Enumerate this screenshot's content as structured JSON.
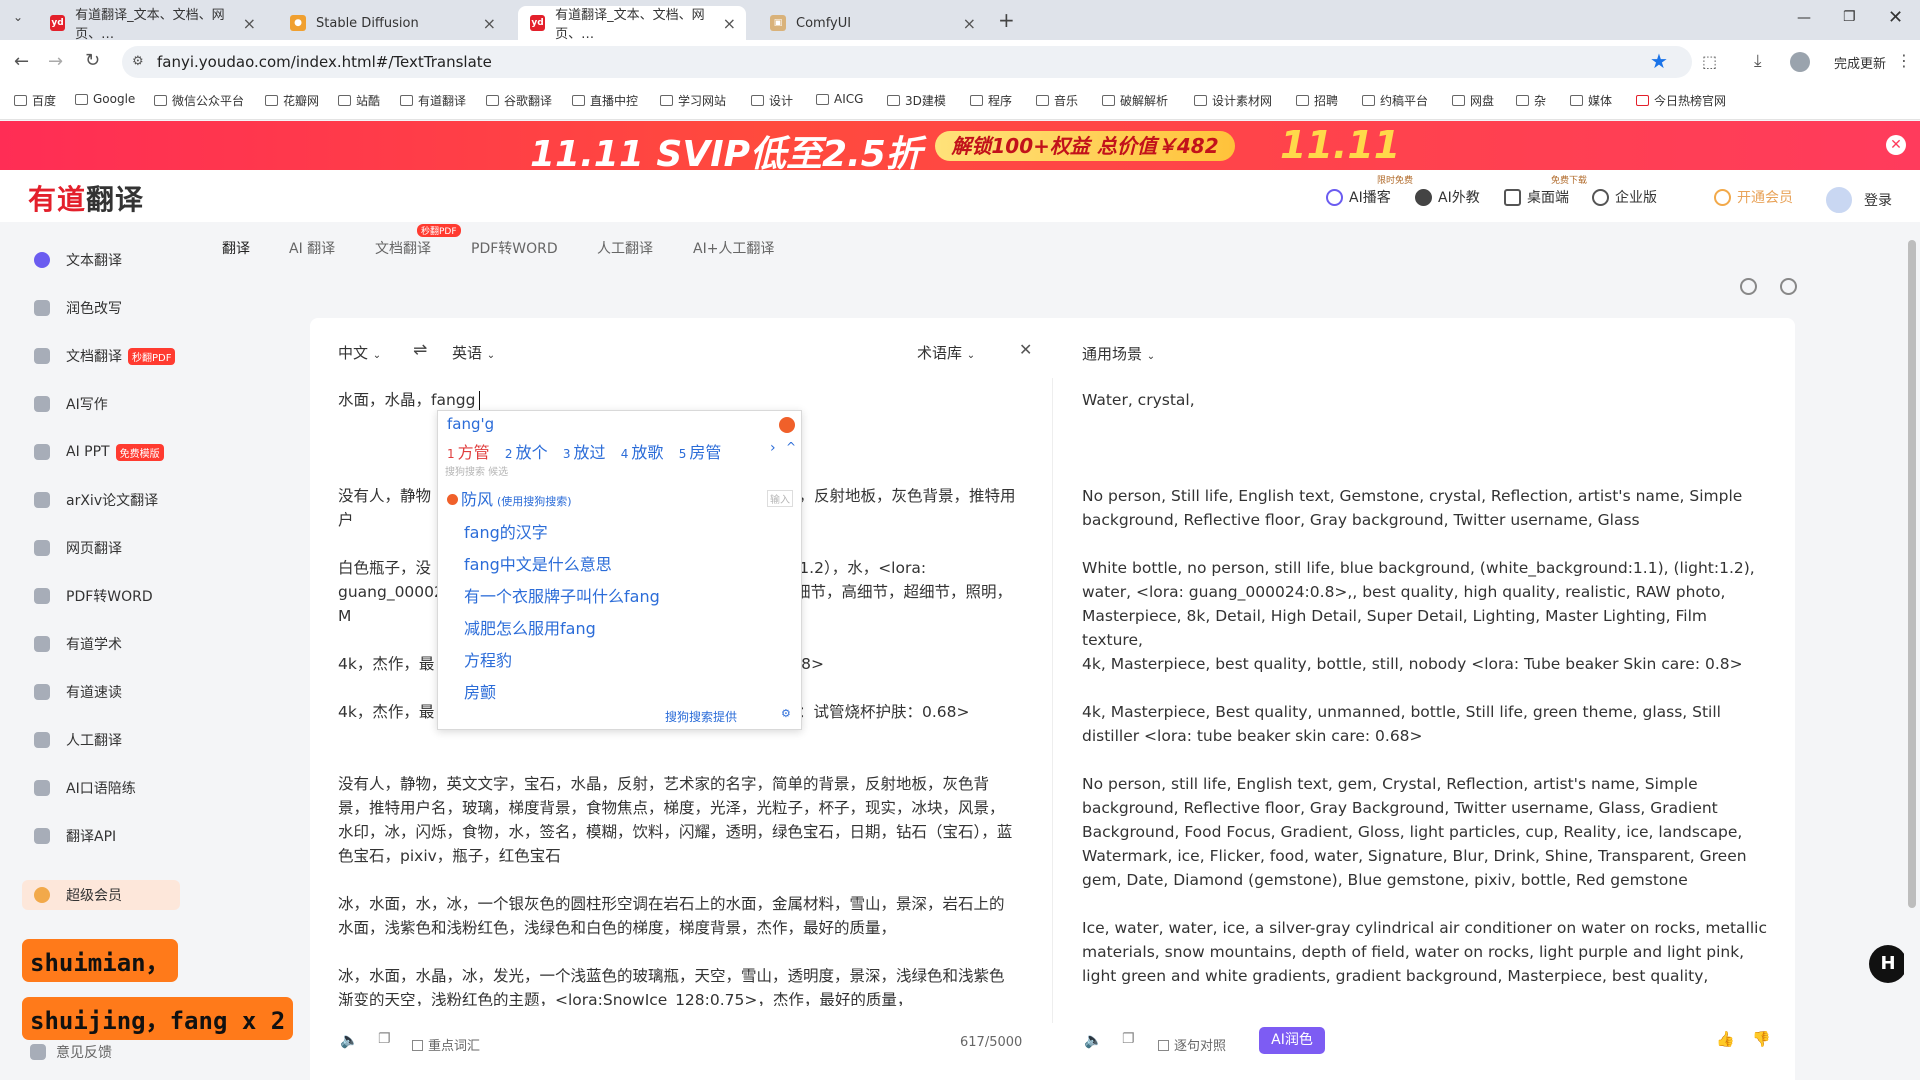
{
  "browser": {
    "tabs": [
      {
        "title": "有道翻译_文本、文档、网页、…",
        "active": false,
        "fav": "yd"
      },
      {
        "title": "Stable Diffusion",
        "active": false,
        "fav": "sd"
      },
      {
        "title": "有道翻译_文本、文档、网页、…",
        "active": true,
        "fav": "yd"
      },
      {
        "title": "ComfyUI",
        "active": false,
        "fav": "cf"
      }
    ],
    "url": "fanyi.youdao.com/index.html#/TextTranslate",
    "update_label": "完成更新",
    "bookmarks": [
      "百度",
      "Google",
      "微信公众平台",
      "花瓣网",
      "站酷",
      "有道翻译",
      "谷歌翻译",
      "直播中控",
      "学习网站",
      "设计",
      "AICG",
      "3D建模",
      "程序",
      "音乐",
      "破解解析",
      "设计素材网",
      "招聘",
      "约稿平台",
      "网盘",
      "杂",
      "媒体",
      "今日热榜官网"
    ]
  },
  "banner": {
    "headline": "11.11 SVIP低至2.5折",
    "pill": "解锁100+权益 总价值￥482",
    "big": "11.11"
  },
  "header": {
    "logo_red": "有道",
    "logo_dark": "翻译",
    "items": [
      "AI播客",
      "AI外教",
      "桌面端",
      "企业版",
      "开通会员",
      "登录"
    ],
    "tags": [
      "限时免费",
      "免费下载"
    ]
  },
  "sidebar": {
    "items": [
      {
        "label": "文本翻译",
        "badge": ""
      },
      {
        "label": "润色改写",
        "badge": ""
      },
      {
        "label": "文档翻译",
        "badge": "秒翻PDF"
      },
      {
        "label": "AI写作",
        "badge": ""
      },
      {
        "label": "AI PPT",
        "badge": "免费模版"
      },
      {
        "label": "arXiv论文翻译",
        "badge": ""
      },
      {
        "label": "网页翻译",
        "badge": ""
      },
      {
        "label": "PDF转WORD",
        "badge": ""
      },
      {
        "label": "有道学术",
        "badge": ""
      },
      {
        "label": "有道速读",
        "badge": ""
      },
      {
        "label": "人工翻译",
        "badge": ""
      },
      {
        "label": "AI口语陪练",
        "badge": ""
      },
      {
        "label": "翻译API",
        "badge": ""
      }
    ],
    "vip": "超级会员",
    "feedback": "意见反馈"
  },
  "toptabs": {
    "items": [
      "翻译",
      "AI 翻译",
      "文档翻译",
      "PDF转WORD",
      "人工翻译",
      "AI+人工翻译"
    ],
    "doc_badge": "秒翻PDF"
  },
  "translator": {
    "source_lang": "中文",
    "swap": "⇌",
    "target_lang": "英语",
    "glossary": "术语库",
    "scene": "通用场景",
    "input_first": "水面，水晶，fangg",
    "src_paras": [
      "没有人，静物                                                              单的背景，反射地板，灰色背景，推特用户",
      "白色瓶子，没                                                              ，（light:1.2），水，<lora: guang_00002                                                          作，8k，细节，高细节，超细节，照明，M",
      "4k，杰作，最                                                              护肤：0.8>",
      "4k，杰作，最                                                              器<lora：试管烧杯护肤：0.68>",
      "没有人，静物，英文文字，宝石，水晶，反射，艺术家的名字，简单的背景，反射地板，灰色背景，推特用户名，玻璃，梯度背景，食物焦点，梯度，光泽，光粒子，杯子，现实，冰块，风景，水印，冰，闪烁，食物，水，签名，模糊，饮料，闪耀，透明，绿色宝石，日期，钻石（宝石），蓝色宝石，pixiv，瓶子，红色宝石",
      "冰，水面，水，冰，一个银灰色的圆柱形空调在岩石上的水面，金属材料，雪山，景深，岩石上的水面，浅紫色和浅粉红色，浅绿色和白色的梯度，梯度背景，杰作，最好的质量，",
      "冰，水面，水晶，冰，发光，一个浅蓝色的玻璃瓶，天空，雪山，透明度，景深，浅绿色和浅紫色渐变的天空，浅粉红色的主题，<lora:SnowIce_128:0.75>，杰作，最好的质量，"
    ],
    "dst_paras": [
      "Water, crystal,",
      "No person, Still life, English text, Gemstone, crystal, Reflection, artist's name, Simple background, Reflective floor, Gray background, Twitter username, Glass",
      "White bottle, no person, still life, blue background, (white_background:1.1), (light:1.2), water, <lora: guang_000024:0.8>,, best quality, high quality, realistic, RAW photo, Masterpiece, 8k, Detail, High Detail, Super Detail, Lighting, Master Lighting, Film texture,",
      "4k, Masterpiece, best quality, bottle, still, nobody <lora: Tube beaker Skin care: 0.8>",
      "4k, Masterpiece, Best quality, unmanned, bottle, Still life, green theme, glass, Still distiller <lora: tube beaker skin care: 0.68>",
      "No person, still life, English text, gem, Crystal, Reflection, artist's name, Simple background, Reflective floor, Gray Background, Twitter username, Glass, Gradient Background, Food Focus, Gradient, Gloss, light particles, cup, Reality, ice, landscape, Watermark, ice, Flicker, food, water, Signature, Blur, Drink, Shine, Transparent, Green gem, Date, Diamond (gemstone), Blue gemstone, pixiv, bottle, Red gemstone",
      "Ice, water, water, ice, a silver-gray cylindrical air conditioner on water on rocks, metallic materials, snow mountains, depth of field, water on rocks, light purple and light pink, light green and white gradients, gradient background, Masterpiece, best quality,"
    ],
    "char_count": "617/5000",
    "key_vocab": "重点词汇",
    "sentence_compare": "逐句对照",
    "ai_polish": "AI润色"
  },
  "ime": {
    "query": "fang'g",
    "candidates": [
      {
        "n": "1",
        "w": "方管"
      },
      {
        "n": "2",
        "w": "放个"
      },
      {
        "n": "3",
        "w": "放过"
      },
      {
        "n": "4",
        "w": "放歌"
      },
      {
        "n": "5",
        "w": "房管"
      }
    ],
    "hint1": "搜狗搜索 候选",
    "first_suggestion": "防风",
    "first_note": "(使用搜狗搜索)",
    "input_tag": "输入",
    "suggestions": [
      "fang的汉字",
      "fang中文是什么意思",
      "有一个衣服牌子叫什么fang",
      "减肥怎么服用fang",
      "方程豹",
      "房颤"
    ],
    "provider": "搜狗搜索提供"
  },
  "overlay": {
    "line1": "shuimian，",
    "line2": "shuijing，fang x 2"
  },
  "colors": {
    "brand": "#e3202b",
    "accent": "#7d5cf3",
    "link": "#2b6cd8",
    "overlay": "#ff7a1a"
  }
}
